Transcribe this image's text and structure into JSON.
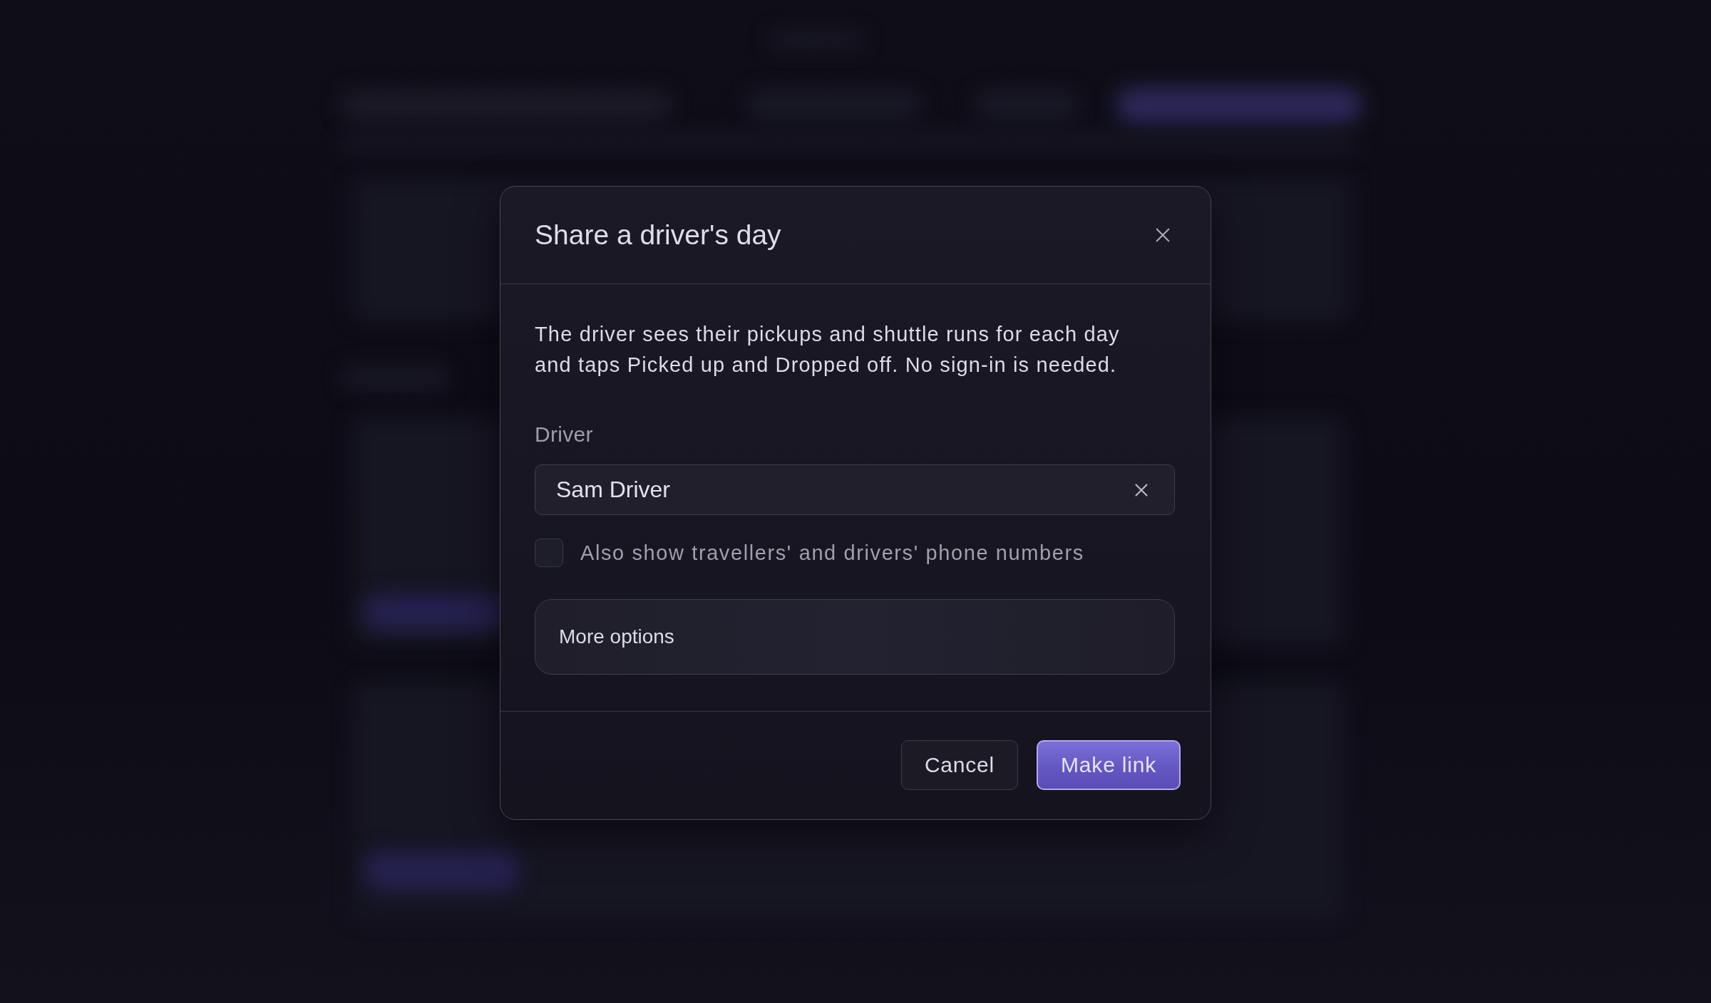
{
  "dialog": {
    "title": "Share a driver's day",
    "description": "The driver sees their pickups and shuttle runs for each day and taps Picked up and Dropped off. No sign-in is needed.",
    "driver_field": {
      "label": "Driver",
      "value": "Sam Driver"
    },
    "phone_checkbox": {
      "label": "Also show travellers' and drivers' phone numbers",
      "checked": false
    },
    "more_options": {
      "label": "More options"
    },
    "buttons": [
      {
        "label": "Cancel",
        "kind": "secondary"
      },
      {
        "label": "Make link",
        "kind": "primary"
      }
    ]
  }
}
